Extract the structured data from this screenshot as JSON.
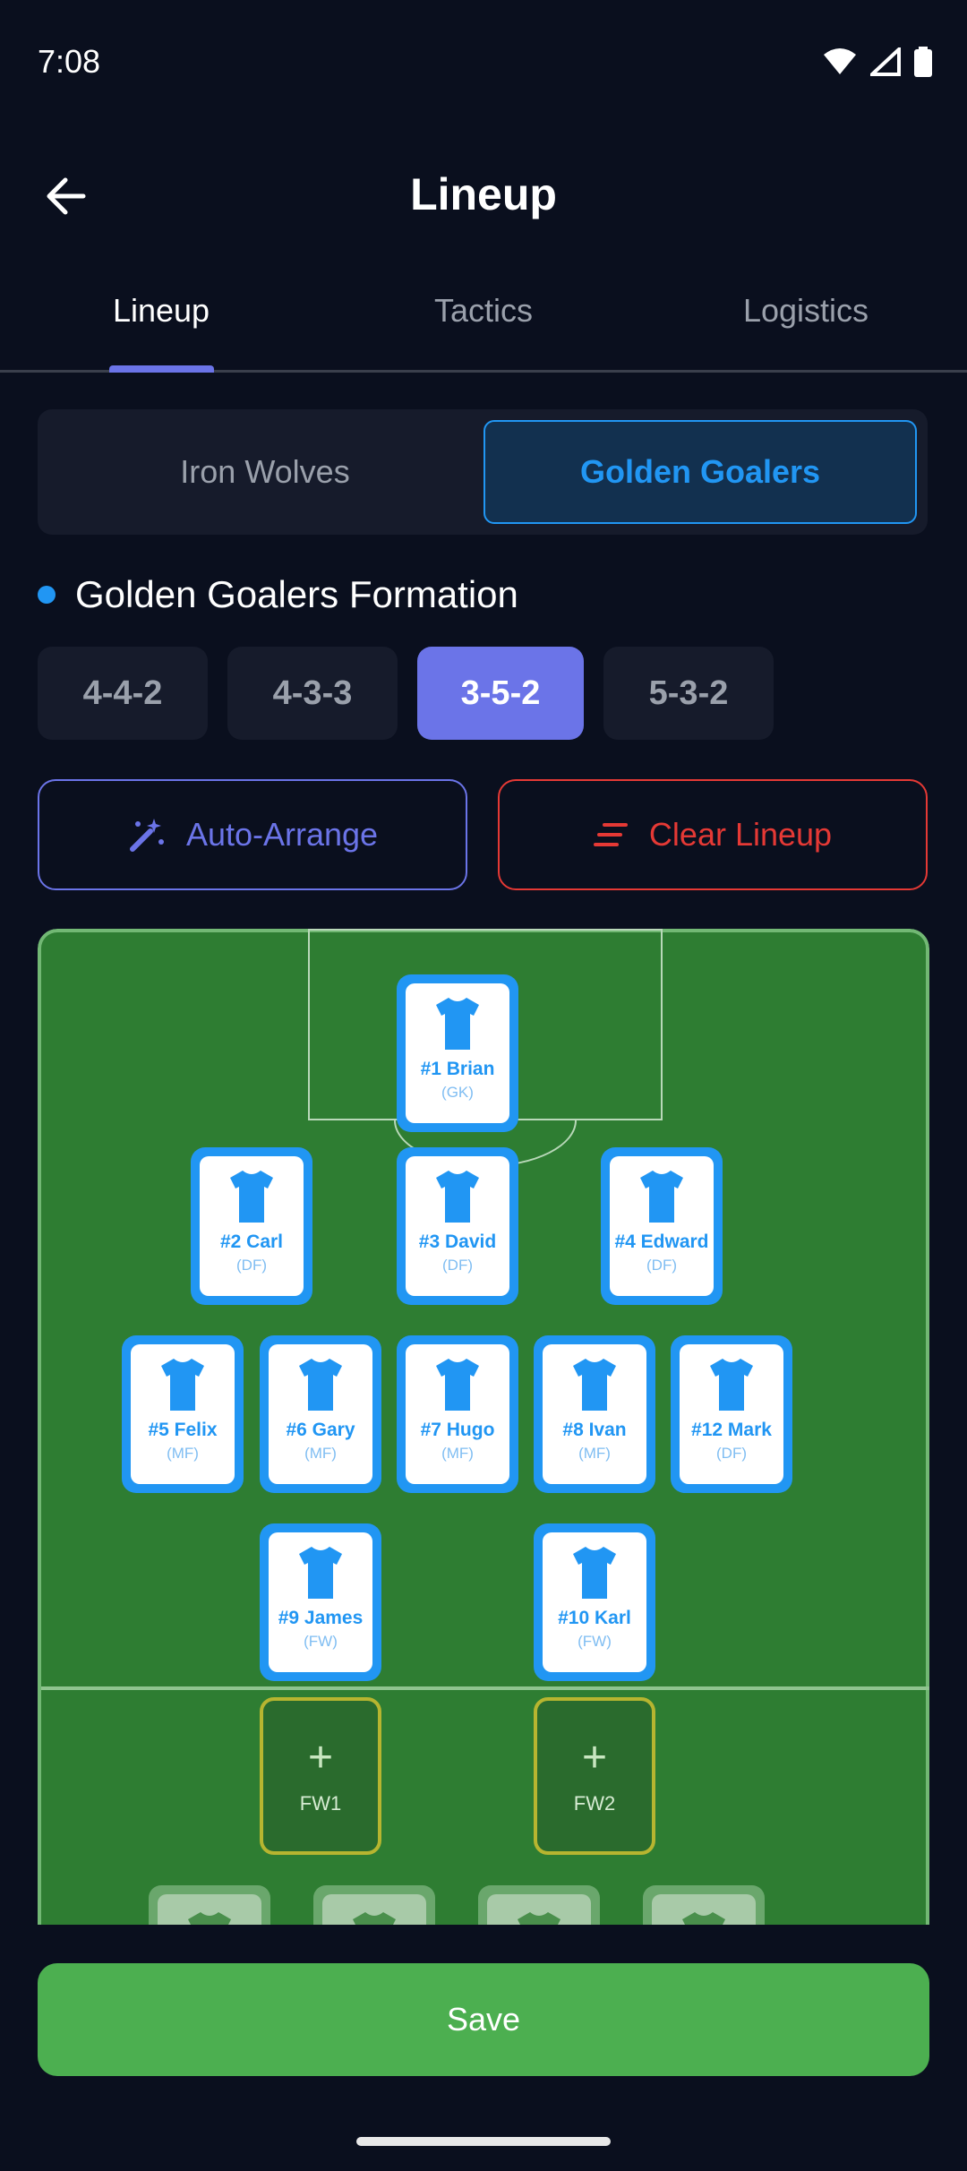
{
  "status_bar": {
    "time": "7:08"
  },
  "app_bar": {
    "title": "Lineup"
  },
  "tabs": [
    {
      "label": "Lineup",
      "active": true
    },
    {
      "label": "Tactics",
      "active": false
    },
    {
      "label": "Logistics",
      "active": false
    }
  ],
  "teams": {
    "left": "Iron Wolves",
    "right": "Golden Goalers",
    "selected": "Golden Goalers"
  },
  "formation": {
    "title": "Golden Goalers Formation",
    "options": [
      "4-4-2",
      "4-3-3",
      "3-5-2",
      "5-3-2"
    ],
    "selected": "3-5-2"
  },
  "actions": {
    "auto_arrange": "Auto-Arrange",
    "clear_lineup": "Clear Lineup"
  },
  "players": [
    {
      "name": "#1 Brian",
      "pos": "(GK)"
    },
    {
      "name": "#2 Carl",
      "pos": "(DF)"
    },
    {
      "name": "#3 David",
      "pos": "(DF)"
    },
    {
      "name": "#4 Edward",
      "pos": "(DF)"
    },
    {
      "name": "#5 Felix",
      "pos": "(MF)"
    },
    {
      "name": "#6 Gary",
      "pos": "(MF)"
    },
    {
      "name": "#7 Hugo",
      "pos": "(MF)"
    },
    {
      "name": "#8 Ivan",
      "pos": "(MF)"
    },
    {
      "name": "#12 Mark",
      "pos": "(DF)"
    },
    {
      "name": "#9 James",
      "pos": "(FW)"
    },
    {
      "name": "#10 Karl",
      "pos": "(FW)"
    }
  ],
  "empty_slots": [
    {
      "label": "FW1"
    },
    {
      "label": "FW2"
    }
  ],
  "save_label": "Save",
  "colors": {
    "accent": "#6b74e8",
    "team_blue": "#2196f3",
    "danger": "#e53935",
    "pitch": "#2e7d32",
    "save": "#4caf50",
    "background": "#0a0f1e"
  }
}
